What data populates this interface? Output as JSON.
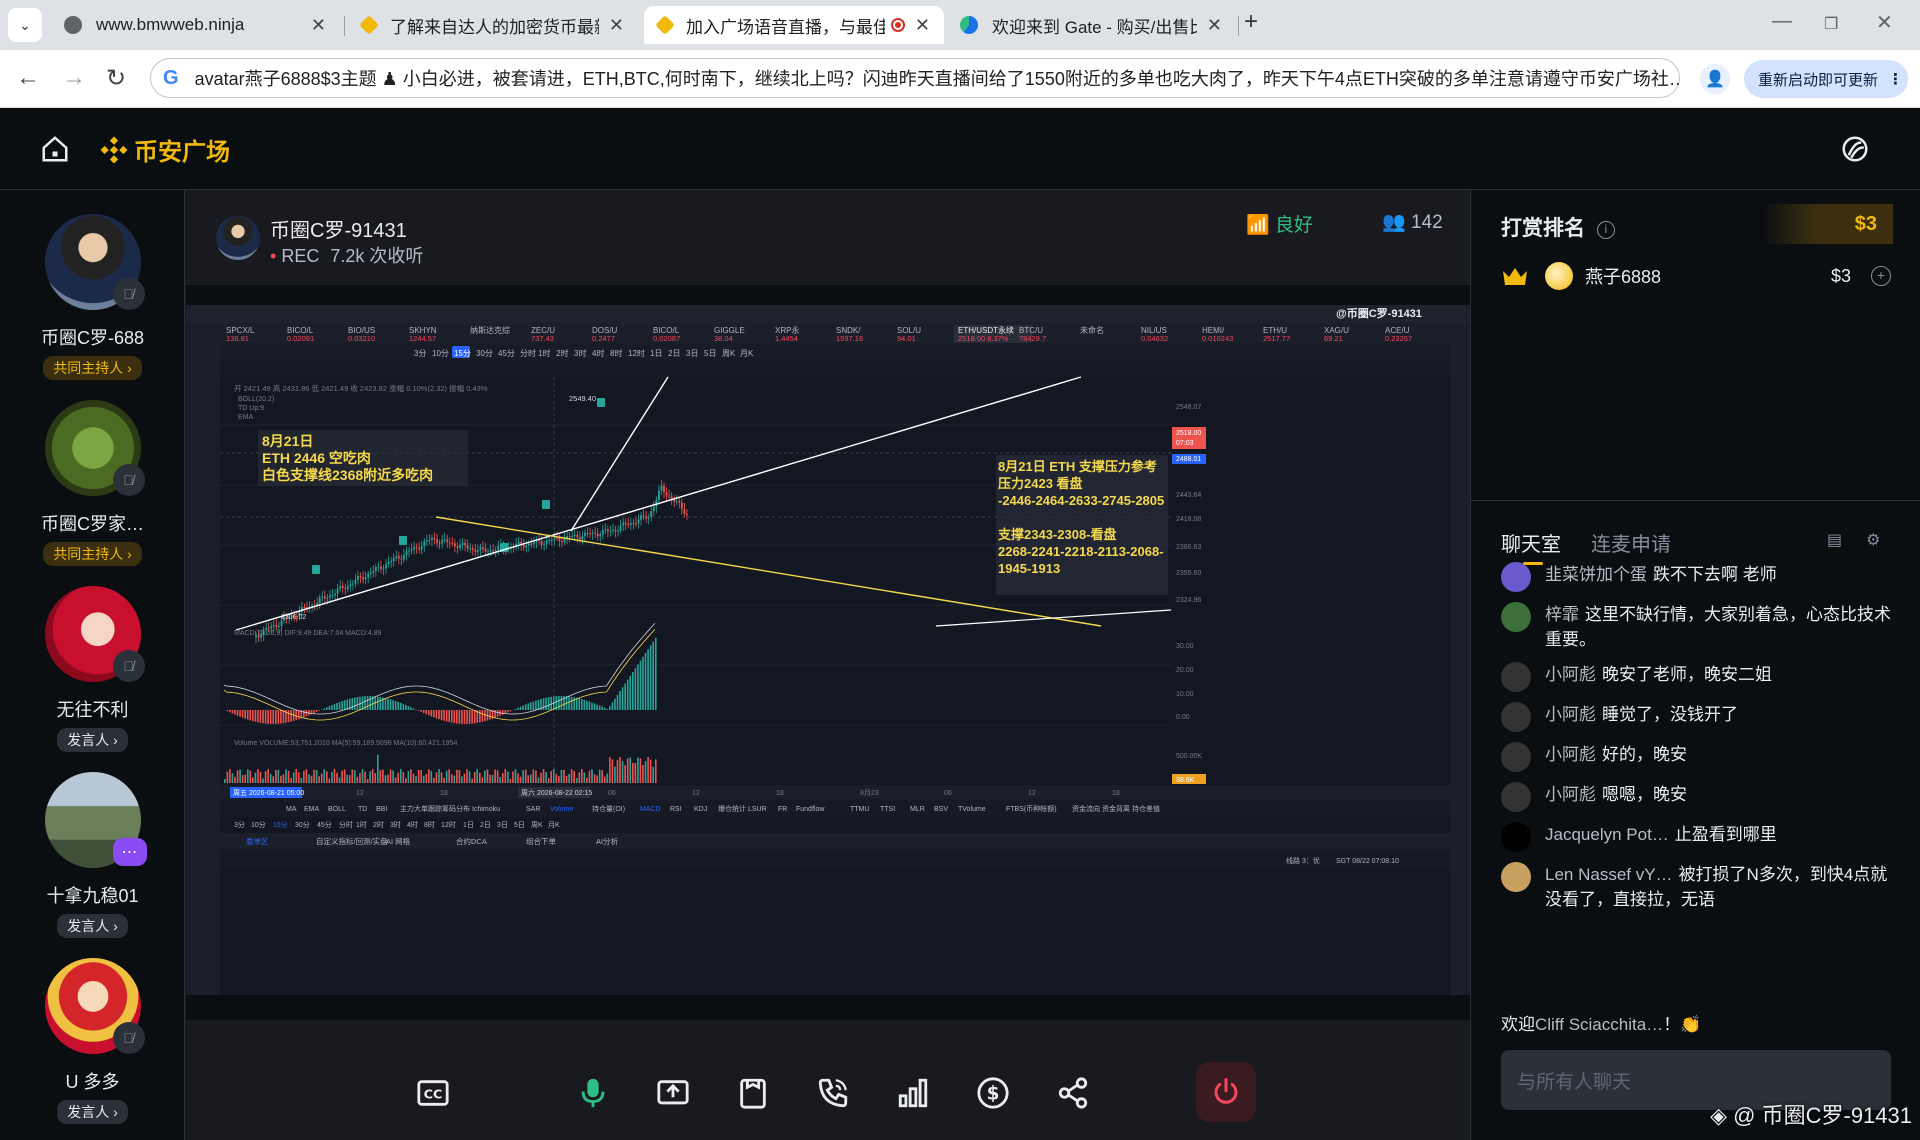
{
  "browser": {
    "tabs": [
      {
        "title": "www.bmwweb.ninja",
        "active": false,
        "fav_color": "#5f6368"
      },
      {
        "title": "了解来自达人的加密货币最新资",
        "active": false,
        "fav_color": "#f0b90b"
      },
      {
        "title": "加入广场语音直播，与最佳",
        "active": true,
        "fav_color": "#f0b90b"
      },
      {
        "title": "欢迎来到 Gate - 购买/出售比特",
        "active": false,
        "fav_color": "#1a73e8"
      }
    ],
    "url": "avatar燕子6888$3主题 ♟ 小白必进，被套请进，ETH,BTC,何时南下，继续北上吗？闪迪昨天直播间给了1550附近的多单也吃大肉了，昨天下午4点ETH突破的多单注意请遵守币安广场社…",
    "update_label": "重新启动即可更新"
  },
  "app": {
    "brand": "币安广场",
    "accent": "#f0b90b"
  },
  "speakers": [
    {
      "name": "币圈C罗-688",
      "role": "共同主持人 ›",
      "type": "host",
      "muted": true
    },
    {
      "name": "币圈C罗家…",
      "role": "共同主持人 ›",
      "type": "host",
      "muted": true
    },
    {
      "name": "无往不利",
      "role": "发言人 ›",
      "type": "speaker",
      "muted": true
    },
    {
      "name": "十拿九稳01",
      "role": "发言人 ›",
      "type": "speaker",
      "muted": false
    },
    {
      "name": "U 多多",
      "role": "发言人 ›",
      "type": "speaker",
      "muted": true
    }
  ],
  "stage": {
    "host_name": "币圈C罗-91431",
    "rec_label": "REC",
    "rec_stats": "7.2k 次收听",
    "network": "良好",
    "listener_count": "142",
    "screen_watermark": "@币圈C罗-91431"
  },
  "tradingview": {
    "ticker_tabs": [
      "SPCX/L",
      "BICO/L",
      "BIO/US",
      "SKHYN",
      "纳斯达克综",
      "ZEC/U",
      "DOS/U",
      "BICO/L",
      "GIGGLE",
      "XRP永",
      "SNDK/",
      "SOL/U",
      "ETH/USDT永续",
      "BTC/U",
      "未命名",
      "NIL/US",
      "HEMI/",
      "ETH/U",
      "XAG/U",
      "ACE/U"
    ],
    "ticker_prices": [
      "136.81",
      "0.02091",
      "0.03210",
      "1244.57",
      "",
      "737.43",
      "0.2477",
      "0.02087",
      "38.04",
      "1.4454",
      "1597.16",
      "94.01",
      "2518.00 8.37%",
      "78429.7",
      "",
      "0.04632",
      "0.010243",
      "2517.77",
      "69.21",
      "0.23267"
    ],
    "timeframes": [
      "3分",
      "10分",
      "15分",
      "30分",
      "45分",
      "分时",
      "1时",
      "2时",
      "3时",
      "4时",
      "8时",
      "12时",
      "1日",
      "2日",
      "3日",
      "5日",
      "周K",
      "月K"
    ],
    "active_timeframe": "15分",
    "ohlc_line": "开 2421.49 高 2431.86 低 2421.49 收 2423.82 涨幅 0.10%(2.32) 振幅 0.43%",
    "indicators": [
      "BOLL(20,2)",
      "TD Up:9",
      "EMA"
    ],
    "annotation_left": [
      "8月21日",
      "ETH 2446 空吃肉",
      "白色支撑线2368附近多吃肉"
    ],
    "annotation_right": [
      "8月21日 ETH 支撑压力参考",
      "压力2423 看盘",
      "-2446-2464-2633-2745-2805",
      "",
      "支撑2343-2308-看盘",
      "2268-2241-2218-2113-2068-",
      "1945-1913"
    ],
    "high_label": "2549.40",
    "low_label": "2306.02",
    "price_axis": [
      "2548.07",
      "2518.00",
      "2488.01",
      "2443.64",
      "2418.08",
      "2386.63",
      "2355.60",
      "2324.96"
    ],
    "current_price": "2518.00",
    "current_time": "07:03",
    "macd_label": "MACD(12,26,9) DIF:9.49 DEA:7.04 MACD:4.89",
    "macd_axis": [
      "30.00",
      "20.00",
      "10.00",
      "0.00"
    ],
    "volume_label": "Volume VOLUME:53,751.2010 MA(5):59,189.5098 MA(10):60,421.1954",
    "volume_axis": [
      "500.00K",
      "38.6K"
    ],
    "time_axis": [
      "12",
      "18",
      "8月21",
      "06",
      "12",
      "18",
      "8月23",
      "06",
      "12",
      "18"
    ],
    "crosshair_date": "周五 2026-08-21 05:00",
    "crosshair_date2": "周六 2026-08-22 02:15",
    "bottom_indicators": [
      "MA",
      "EMA",
      "BOLL",
      "TD",
      "BBI",
      "主力大单跟踪",
      "筹码分布",
      "Ichimoku",
      "SAR",
      "Volume",
      "持仓量(OI)",
      "MACD",
      "RSI",
      "KDJ",
      "爆仓统计",
      "LSUR",
      "FR",
      "Fundflow",
      "TTMU",
      "TTSI",
      "MLR",
      "BSV",
      "TVolume",
      "FTBS(币种帐额)",
      "资金流向",
      "资金背离",
      "持仓差值"
    ],
    "bottom_tabs": [
      "委单区",
      "自定义指标/回测/实盘",
      "AI 网格",
      "合约DCA",
      "组合下单",
      "AI分析"
    ],
    "status_line": "SGT 08/22 07:08:10",
    "line_status": "线路 3：优"
  },
  "tips": {
    "title": "打赏排名",
    "total": "$3",
    "rows": [
      {
        "name": "燕子6888",
        "amount": "$3"
      }
    ]
  },
  "chat": {
    "tabs": [
      "聊天室",
      "连麦申请"
    ],
    "messages": [
      {
        "user": "韭菜饼加个蛋",
        "text": "跌不下去啊 老师",
        "av": "#6a5acd"
      },
      {
        "user": "梓霏",
        "text": "这里不缺行情，大家别着急，心态比技术重要。",
        "av": "#3c6e3c"
      },
      {
        "user": "小阿彪",
        "text": "晚安了老师，晚安二姐",
        "av": "#333"
      },
      {
        "user": "小阿彪",
        "text": "睡觉了，没钱开了",
        "av": "#333"
      },
      {
        "user": "小阿彪",
        "text": "好的，晚安",
        "av": "#333"
      },
      {
        "user": "小阿彪",
        "text": "嗯嗯，晚安",
        "av": "#333"
      },
      {
        "user": "Jacquelyn Pot…",
        "text": "止盈看到哪里",
        "av": "#000"
      },
      {
        "user": "Len Nassef vY…",
        "text": "被打损了N多次，到快4点就没看了，直接拉，无语",
        "av": "#c8a060"
      }
    ],
    "welcome_prefix": "欢迎",
    "welcome_name": "Cliff Sciacchita…",
    "welcome_suffix": "！👏",
    "input_placeholder": "与所有人聊天"
  },
  "watermark": "@ 币圈C罗-91431"
}
